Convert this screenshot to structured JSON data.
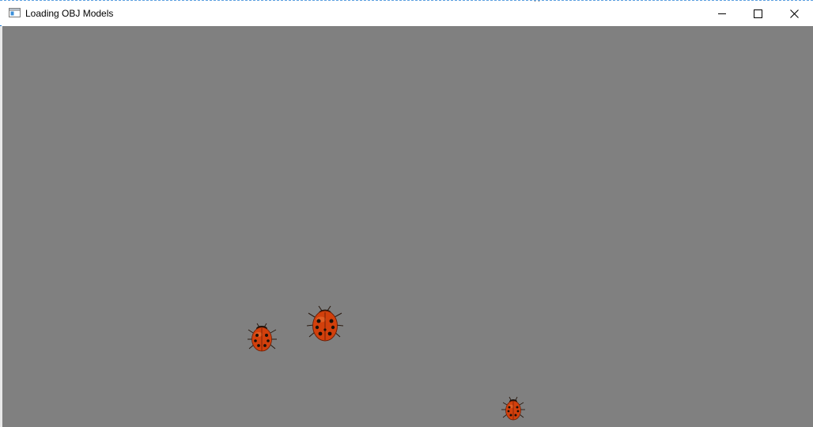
{
  "window": {
    "title": "Loading OBJ Models",
    "controls": {
      "minimize_icon": "minimize-icon",
      "maximize_icon": "maximize-icon",
      "close_icon": "close-icon"
    }
  },
  "scene": {
    "background_color": "#808080",
    "objects": [
      "ladybug",
      "ladybug",
      "ladybug"
    ],
    "colors": {
      "ladybug_shell": "#d2400c",
      "ladybug_spots": "#1a0f08",
      "ladybug_legs": "#2a1a10"
    }
  }
}
